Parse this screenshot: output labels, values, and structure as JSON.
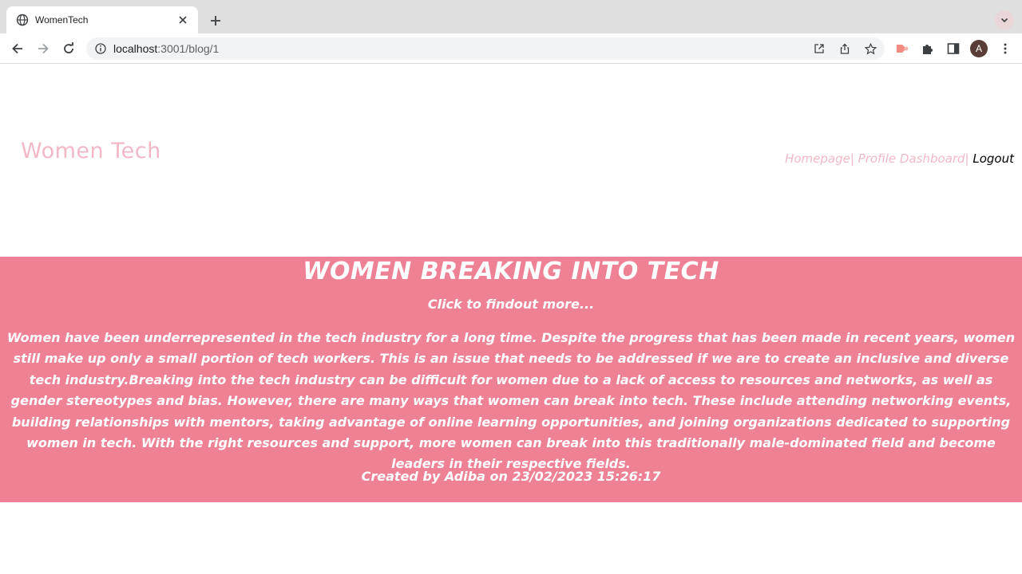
{
  "browser": {
    "tab_title": "WomenTech",
    "url_host": "localhost",
    "url_path": ":3001/blog/1",
    "avatar_letter": "A",
    "icons": [
      "globe-icon",
      "close-icon",
      "plus-icon",
      "chevron-down-icon",
      "back-icon",
      "forward-icon",
      "reload-icon",
      "info-icon",
      "open-external-icon",
      "share-icon",
      "star-icon",
      "extension-color-icon",
      "puzzle-icon",
      "sidepanel-icon",
      "menu-icon"
    ]
  },
  "header": {
    "brand": "Women Tech",
    "nav": {
      "homepage": "Homepage|",
      "profile": " Profile Dashboard|",
      "logout": " Logout"
    }
  },
  "post": {
    "title": "WOMEN BREAKING INTO TECH",
    "more": "Click to findout more...",
    "body": "Women have been underrepresented in the tech industry for a long time. Despite the progress that has been made in recent years, women still make up only a small portion of tech workers. This is an issue that needs to be addressed if we are to create an inclusive and diverse tech industry.Breaking into the tech industry can be difficult for women due to a lack of access to resources and networks, as well as gender stereotypes and bias. However, there are many ways that women can break into tech. These include attending networking events, building relationships with mentors, taking advantage of online learning opportunities, and joining organizations dedicated to supporting women in tech. With the right resources and support, more women can break into this traditionally male-dominated field and become leaders in their respective fields.",
    "meta": "Created by Adiba on 23/02/2023 15:26:17"
  },
  "colors": {
    "accent_pink": "#ee8294",
    "brand_pink": "#f2b8c6"
  }
}
